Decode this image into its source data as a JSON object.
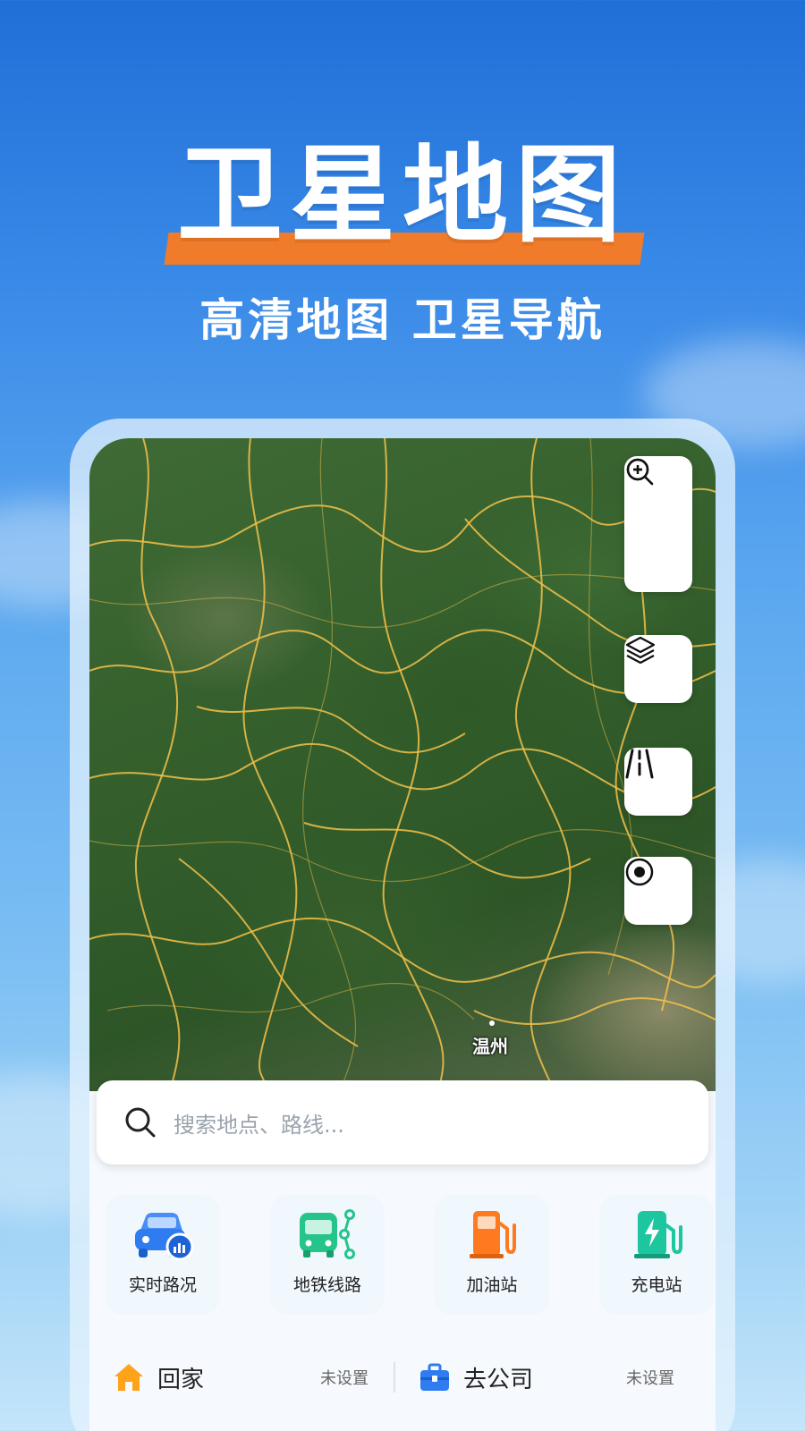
{
  "hero": {
    "title": "卫星地图",
    "subtitle": "高清地图 卫星导航"
  },
  "map": {
    "city_label": "温州",
    "controls": {
      "zoom_in": "zoom-in-icon",
      "zoom_out": "zoom-out-icon",
      "layers": "layers-icon",
      "road": "road-icon",
      "locate": "locate-icon"
    }
  },
  "search": {
    "placeholder": "搜索地点、路线..."
  },
  "shortcuts": [
    {
      "label": "实时路况",
      "icon": "car-traffic-icon",
      "color": "#2f7cf0"
    },
    {
      "label": "地铁线路",
      "icon": "bus-route-icon",
      "color": "#25c48a"
    },
    {
      "label": "加油站",
      "icon": "gas-station-icon",
      "color": "#ff7a1f"
    },
    {
      "label": "充电站",
      "icon": "charging-station-icon",
      "color": "#1ec6a0"
    }
  ],
  "places": {
    "home": {
      "name": "回家",
      "status": "未设置",
      "icon_color": "#ffa31a"
    },
    "work": {
      "name": "去公司",
      "status": "未设置",
      "icon_color": "#2f7cf0"
    }
  },
  "colors": {
    "accent_orange": "#f07b2a",
    "road_yellow": "#f3c14a"
  }
}
